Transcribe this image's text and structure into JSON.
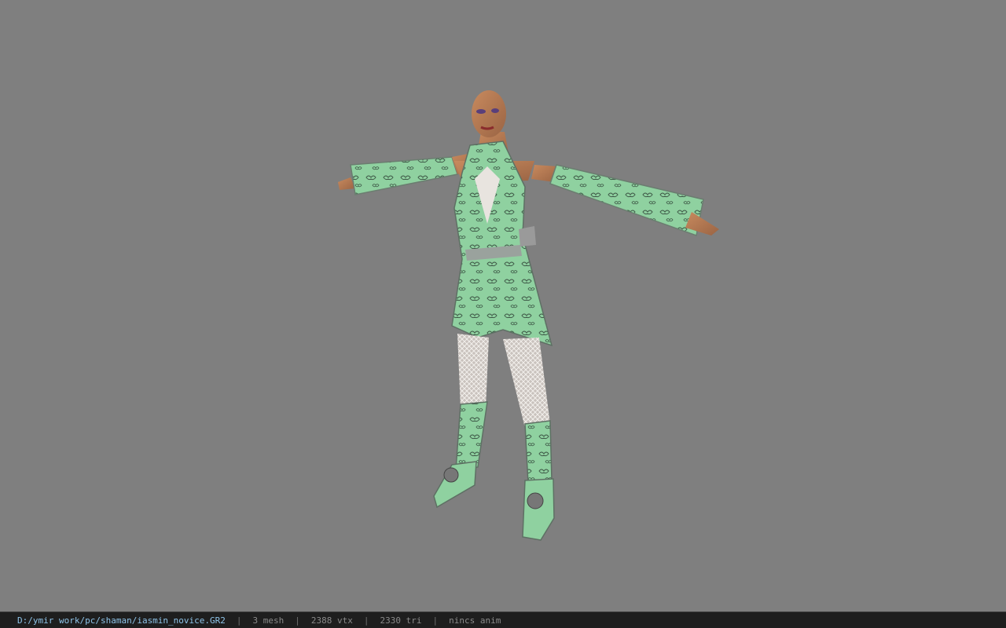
{
  "viewport": {
    "background": "#7f7f7f",
    "model_name": "iasmin_novice",
    "outfit_color": "#8fd1a0"
  },
  "statusbar": {
    "file_path": "D:/ymir work/pc/shaman/iasmin_novice.GR2",
    "separator": "|",
    "mesh_count": "3 mesh",
    "vertex_count": "2388 vtx",
    "triangle_count": "2330 tri",
    "anim_status": "nincs anim"
  }
}
